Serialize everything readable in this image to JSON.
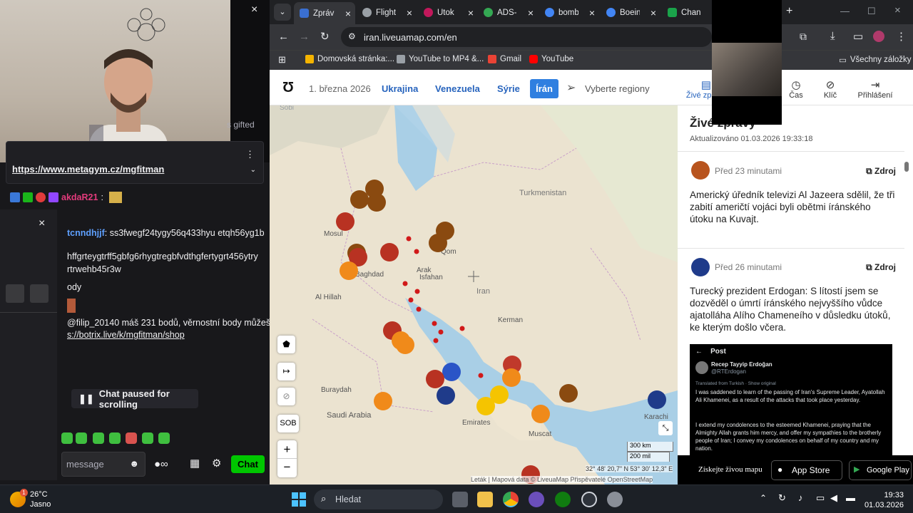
{
  "stream": {
    "close_label": "×",
    "gifted_text": "s gifted",
    "pinned_link": "https://www.metagym.cz/mgfitman",
    "chat": [
      {
        "user": "akdaR21",
        "text": ":"
      },
      {
        "user": "tcnndhjjf",
        "text": ": ss3fwegf24tygy56q433hyu etqh56yg1b"
      },
      {
        "text": "hffgrteygtrff5gbfg6rhygtregbfvdthgfertygrt456ytry"
      },
      {
        "text": "rtrwehb45r3w"
      },
      {
        "text": "ody"
      },
      {
        "text": "@filip_20140 máš 231 bodů, věrnostní body můžeš"
      },
      {
        "text": "s://botrix.live/k/mgfitman/shop"
      }
    ],
    "paused_label": "Chat paused for scrolling",
    "input_placeholder": "message",
    "chat_button": "Chat"
  },
  "browser": {
    "tabs": [
      {
        "label": "Zpráv",
        "color": "#3a6fd1"
      },
      {
        "label": "Flight",
        "color": "#e8eaed"
      },
      {
        "label": "Útok",
        "color": "#c2185b"
      },
      {
        "label": "ADS-I",
        "color": "#34a853"
      },
      {
        "label": "bomb",
        "color": "#4285f4"
      },
      {
        "label": "Boein",
        "color": "#4285f4"
      },
      {
        "label": "Chan",
        "color": "#1aa34a"
      }
    ],
    "new_tab": "+",
    "url": "iran.liveuamap.com/en",
    "bookmarks": [
      "Domovská stránka:...",
      "YouTube to MP4 &...",
      "Gmail",
      "YouTube"
    ],
    "all_bookmarks": "Všechny záložky"
  },
  "site": {
    "date": "1. března 2026",
    "regions": [
      "Ukrajina",
      "Venezuela",
      "Sýrie",
      "Írán"
    ],
    "select_regions": "Vyberte regiony",
    "right_tabs": [
      "Živé zprávy",
      "Čas",
      "Klíč",
      "Přihlášení"
    ],
    "live_title": "Živé zprávy",
    "updated": "Aktualizováno 01.03.2026 19:33:18",
    "cards": [
      {
        "time": "Před 23 minutami",
        "source": "Zdroj",
        "text": "Americký úředník televizi Al Jazeera sdělil, že tři zabití američtí vojáci byli obětmi íránského útoku na Kuvajt."
      },
      {
        "time": "Před 26 minutami",
        "source": "Zdroj",
        "text": "Turecký prezident Erdogan: S lítostí jsem se dozvěděl o úmrtí íránského nejvyššího vůdce ajatolláha Alího Chameneího v důsledku útoků, ke kterým došlo včera."
      }
    ],
    "tweet": {
      "header": "Post",
      "name": "Recep Tayyip Erdoğan",
      "handle": "@RTErdogan",
      "translated": "Translated from Turkish · Show original",
      "p1": "I was saddened to learn of the passing of Iran's Supreme Leader, Ayatollah Ali Khamenei, as a result of the attacks that took place yesterday.",
      "p2": "I extend my condolences to the esteemed Khamenei, praying that the Almighty Allah grants him mercy, and offer my sympathies to the brotherly people of Iran; I convey my condolences on behalf of my country and my nation."
    },
    "app_banner": "Získejte živou mapu",
    "app_store": "App Store",
    "google_play": "Google Play",
    "map_labels": [
      "Sobi",
      "Iran",
      "Baghdad",
      "Isfahan",
      "Qom",
      "Arak",
      "Mosul",
      "Kerman",
      "Al Hillah",
      "Buraydah",
      "Saudi Arabia",
      "Emirates",
      "Muscat",
      "Karachi",
      "Turkmenistan"
    ],
    "scale": [
      "300 km",
      "200 mil"
    ],
    "coords": "32° 48' 20,7\" N 53° 30' 12,3\" E",
    "attribution": "Leták | Mapová data © LiveuaMap Přispěvatelé OpenStreetMap",
    "sob_label": "SOB",
    "zoom_in": "+",
    "zoom_out": "−"
  },
  "taskbar": {
    "temp": "26°C",
    "weather": "Jasno",
    "badge": "1",
    "search": "Hledat",
    "time": "19:33",
    "date": "01.03.2026"
  }
}
